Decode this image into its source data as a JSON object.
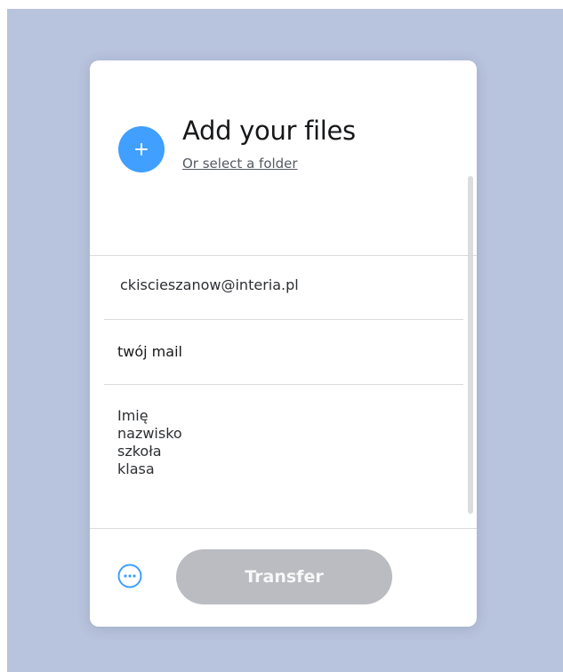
{
  "upload": {
    "title": "Add your files",
    "select_folder": "Or select a folder"
  },
  "form": {
    "email_to": "ckiscieszanow@interia.pl",
    "email_from": "twój mail",
    "message_lines": [
      "Imię",
      "nazwisko",
      "szkoła",
      "klasa"
    ]
  },
  "footer": {
    "transfer_label": "Transfer",
    "more_icon": "ellipsis-circle-icon"
  },
  "colors": {
    "accent": "#409fff",
    "background": "#b8c3dd",
    "button_disabled": "#babcc1"
  }
}
